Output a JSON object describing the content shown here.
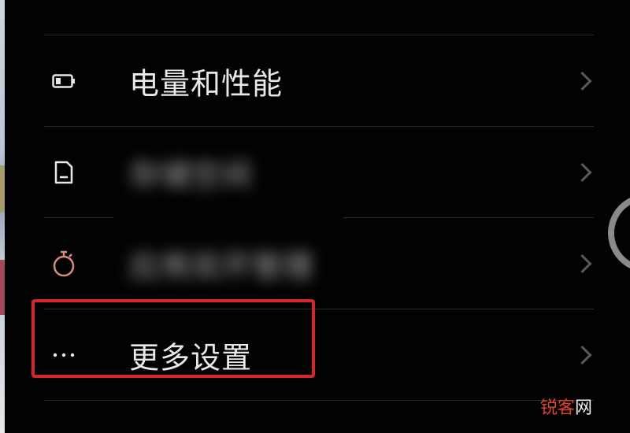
{
  "settings_list": {
    "items": [
      {
        "label": "电量和性能",
        "icon": "battery-icon",
        "blurred": false
      },
      {
        "label": "存储空间",
        "icon": "storage-icon",
        "blurred": true
      },
      {
        "label": "应用双开管理",
        "icon": "timer-icon",
        "blurred": true
      },
      {
        "label": "更多设置",
        "icon": "more-dots-icon",
        "blurred": false
      }
    ]
  },
  "watermark": {
    "part1": "锐客",
    "part2": "网"
  },
  "colors": {
    "background": "#020202",
    "text": "#e8e8e8",
    "divider": "#2a2a2a",
    "chevron": "#5a5a5a",
    "highlight": "#d8262e",
    "timer_icon": "#d98b7a"
  }
}
